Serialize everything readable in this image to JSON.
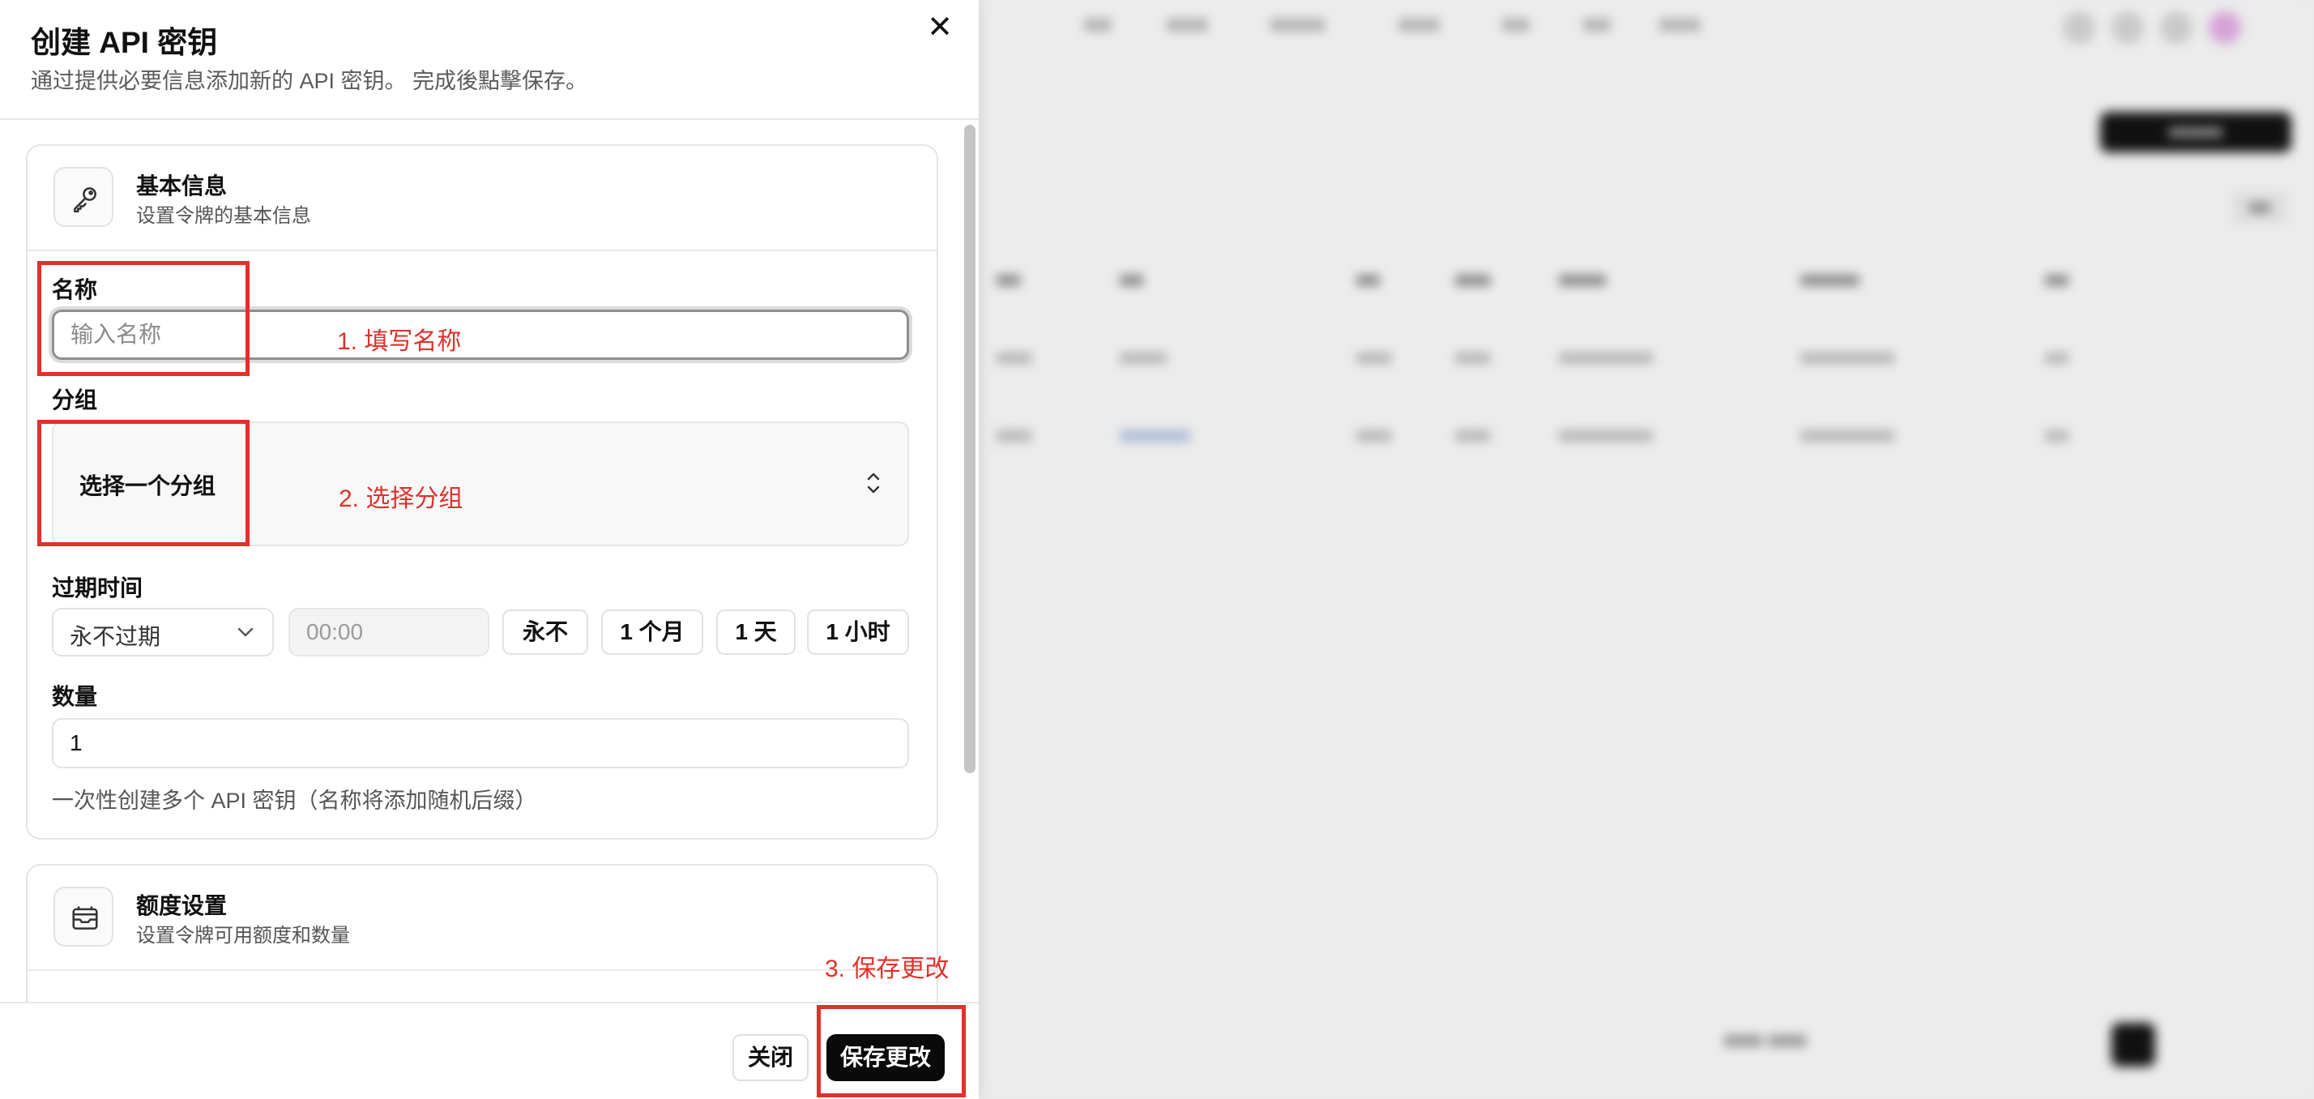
{
  "dialog": {
    "title": "创建 API 密钥",
    "subtitle": "通过提供必要信息添加新的 API 密钥。 完成後點擊保存。",
    "close_symbol": "✕"
  },
  "basic_section": {
    "title": "基本信息",
    "description": "设置令牌的基本信息",
    "icon": "key-icon",
    "name_label": "名称",
    "name_placeholder": "输入名称",
    "name_value": "",
    "group_label": "分组",
    "group_value": "选择一个分组",
    "expiry_label": "过期时间",
    "expiry_select_value": "永不过期",
    "expiry_time_placeholder": "00:00",
    "quick_options": [
      "永不",
      "1 个月",
      "1 天",
      "1 小时"
    ],
    "quantity_label": "数量",
    "quantity_value": "1",
    "quantity_help": "一次性创建多个 API 密钥（名称将添加随机后缀）"
  },
  "quota_section": {
    "title": "额度设置",
    "description": "设置令牌可用额度和数量",
    "icon": "wallet-icon"
  },
  "footer": {
    "close_label": "关闭",
    "save_label": "保存更改"
  },
  "annotations": {
    "step1": "1. 填写名称",
    "step2": "2. 选择分组",
    "step3": "3. 保存更改",
    "color": "#e0312b"
  }
}
